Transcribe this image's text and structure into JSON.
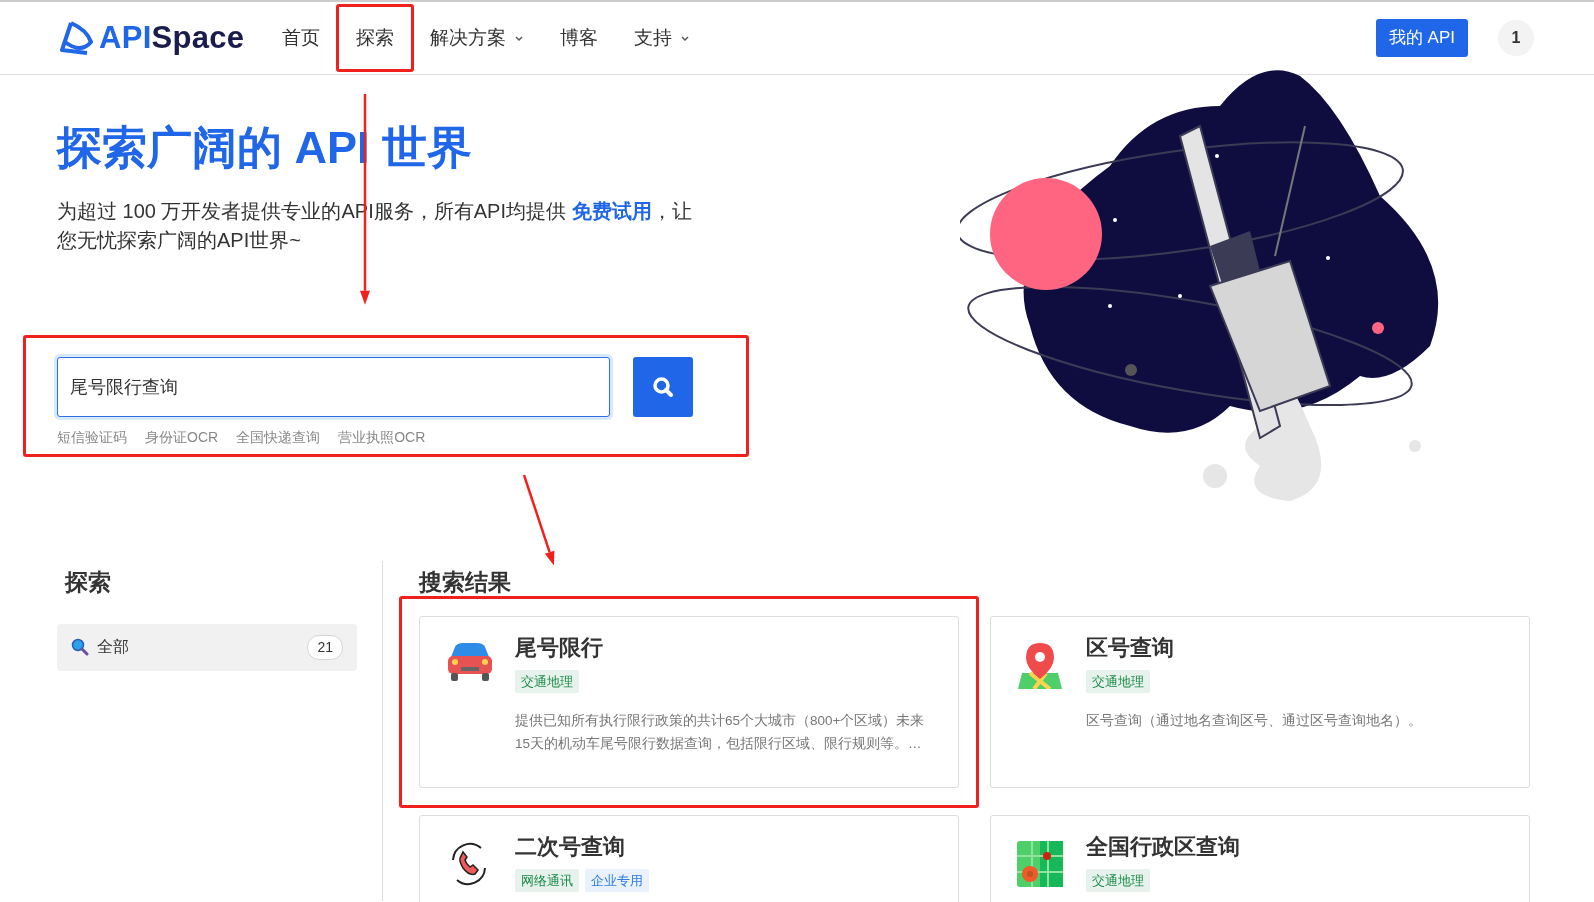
{
  "logo": {
    "parts": [
      "API",
      "Space"
    ]
  },
  "nav": [
    {
      "label": "首页",
      "dropdown": false,
      "annotated": false
    },
    {
      "label": "探索",
      "dropdown": false,
      "annotated": true,
      "arrow_below": true
    },
    {
      "label": "解决方案",
      "dropdown": true,
      "annotated": false
    },
    {
      "label": "博客",
      "dropdown": false,
      "annotated": false
    },
    {
      "label": "支持",
      "dropdown": true,
      "annotated": false
    }
  ],
  "my_api_button": "我的 API",
  "user_avatar": "1",
  "hero": {
    "title": "探索广阔的 API 世界",
    "subtitle": "为超过 100 万开发者提供专业的API服务，所有API均提供 **免费试用**，让您无忧探索广阔的API世界~"
  },
  "search": {
    "value": "尾号限行查询",
    "annotated": true,
    "arrow_below": true,
    "hot": [
      "短信验证码",
      "身份证OCR",
      "全国快递查询",
      "营业执照OCR"
    ]
  },
  "sidebar": {
    "title": "探索",
    "items": [
      {
        "label": "全部",
        "count": "21",
        "selected": true
      }
    ]
  },
  "results": {
    "title": "搜索结果",
    "cards": [
      {
        "kind": "car",
        "title": "尾号限行",
        "annotated": true,
        "tags": [
          {
            "label": "交通地理",
            "color": "#1b8a4a"
          }
        ],
        "description": "提供已知所有执行限行政策的共计65个大城市（800+个区域）未来15天的机动车尾号限行数据查询，包括限行区域、限行规则等。…"
      },
      {
        "kind": "pin",
        "title": "区号查询",
        "annotated": false,
        "tags": [
          {
            "label": "交通地理",
            "color": "#1b8a4a"
          }
        ],
        "description": "区号查询（通过地名查询区号、通过区号查询地名）。"
      },
      {
        "kind": "phone",
        "title": "二次号查询",
        "annotated": false,
        "tags": [
          {
            "label": "网络通讯",
            "color": "#1b8a4a"
          },
          {
            "label": "企业专用",
            "color": "#2f7de1"
          }
        ]
      },
      {
        "kind": "grid",
        "title": "全国行政区查询",
        "annotated": false,
        "tags": [
          {
            "label": "交通地理",
            "color": "#1b8a4a"
          }
        ]
      }
    ]
  }
}
